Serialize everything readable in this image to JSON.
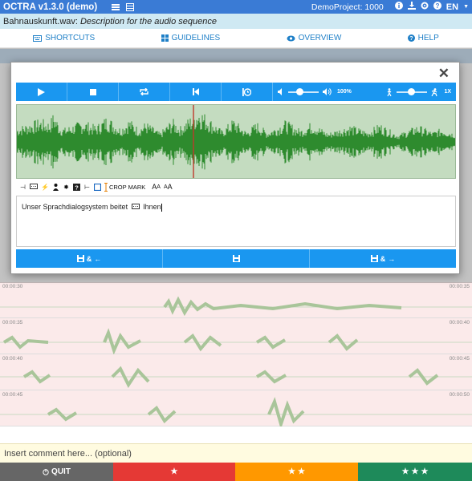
{
  "app": {
    "title": "OCTRA v1.3.0 (demo)",
    "project": "DemoProject: 1000",
    "language": "EN"
  },
  "file": {
    "name": "Bahnauskunft.wav:",
    "description": "Description for the audio sequence"
  },
  "nav": {
    "shortcuts": "SHORTCUTS",
    "guidelines": "GUIDELINES",
    "overview": "OVERVIEW",
    "help": "HELP"
  },
  "player": {
    "volume_label": "100%",
    "speed_label": "1X",
    "volume_level": 0.5,
    "speed_level": 0.5
  },
  "markers": {
    "crop_mark": "CROP MARK",
    "font_large": "A",
    "font_small": "A"
  },
  "editor": {
    "text_before": "Unser Sprachdialogsystem beitet",
    "text_after": "Ihnen"
  },
  "savebar": {
    "prev": "&",
    "next": "&"
  },
  "background_rows": [
    {
      "start": "00:00:30",
      "end": "00:00:35"
    },
    {
      "start": "00:00:35",
      "end": "00:00:40"
    },
    {
      "start": "00:00:40",
      "end": "00:00:45"
    },
    {
      "start": "00:00:45",
      "end": "00:00:50"
    }
  ],
  "comment": {
    "placeholder": "Insert comment here... (optional)"
  },
  "bottom": {
    "quit": "QUIT"
  },
  "colors": {
    "topbar": "#3a7bd5",
    "accent": "#1a97f0",
    "waveform": "#2e8b2e",
    "quit": "#666666",
    "one_star": "#e53935",
    "two_star": "#ff9800",
    "three_star": "#1e8a5a"
  }
}
